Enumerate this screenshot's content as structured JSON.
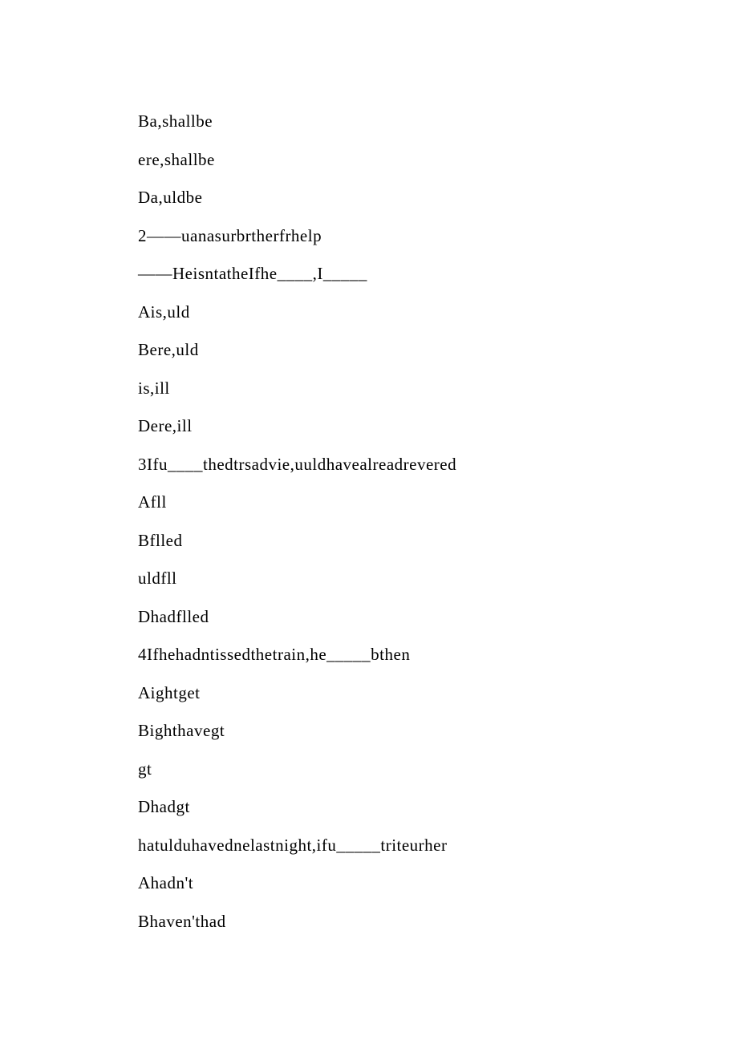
{
  "lines": [
    "Ba,shallbe",
    "ere,shallbe",
    "Da,uldbe",
    "2——uanasurbrtherfrhelp",
    "——HeisntatheIfhe____,I_____",
    "Ais,uld",
    "Bere,uld",
    "is,ill",
    "Dere,ill",
    "3Ifu____thedtrsadvie,uuldhavealreadrevered",
    "Afll",
    "Bflled",
    "uldfll",
    "Dhadflled",
    "4Ifhehadntissedthetrain,he_____bthen",
    "Aightget",
    "Bighthavegt",
    "gt",
    "Dhadgt",
    "hatulduhavednelastnight,ifu_____triteurher",
    "Ahadn't",
    "Bhaven'thad"
  ]
}
